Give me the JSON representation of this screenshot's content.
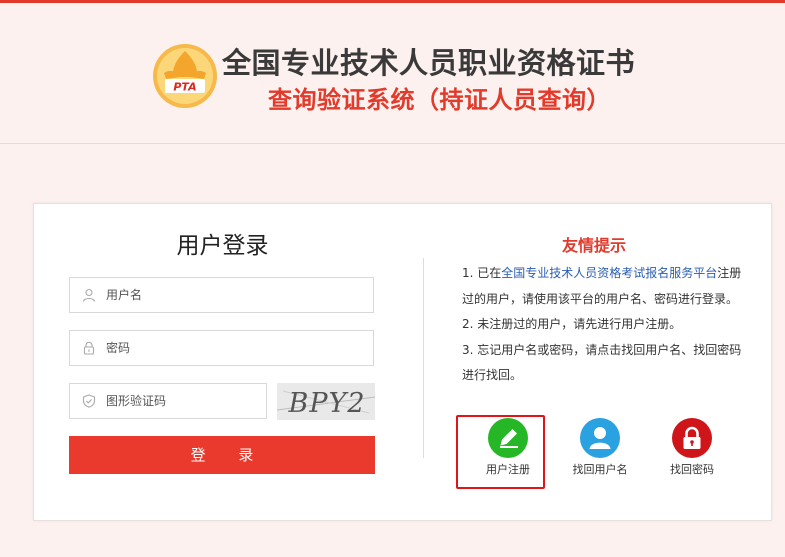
{
  "header": {
    "logo_text": "PTA",
    "title_line1": "全国专业技术人员职业资格证书",
    "title_line2": "查询验证系统（持证人员查询）"
  },
  "login": {
    "title": "用户登录",
    "username_placeholder": "用户名",
    "password_placeholder": "密码",
    "captcha_placeholder": "图形验证码",
    "captcha_text": "BPY2",
    "submit_label": "登 录"
  },
  "tips": {
    "title": "友情提示",
    "item1_prefix": "1. 已在",
    "item1_link": "全国专业技术人员资格考试报名服务平台",
    "item1_suffix": "注册过的用户，请使用该平台的用户名、密码进行登录。",
    "item2": "2. 未注册过的用户，请先进行用户注册。",
    "item3": "3. 忘记用户名或密码，请点击找回用户名、找回密码进行找回。"
  },
  "actions": {
    "register_label": "用户注册",
    "recover_username_label": "找回用户名",
    "recover_password_label": "找回密码"
  },
  "colors": {
    "accent_red": "#ea3a2e",
    "title_red": "#e23b2c",
    "link_blue": "#2a5db0",
    "register_green": "#26b726",
    "user_blue": "#2aa1e0",
    "lock_red": "#d0151a"
  }
}
